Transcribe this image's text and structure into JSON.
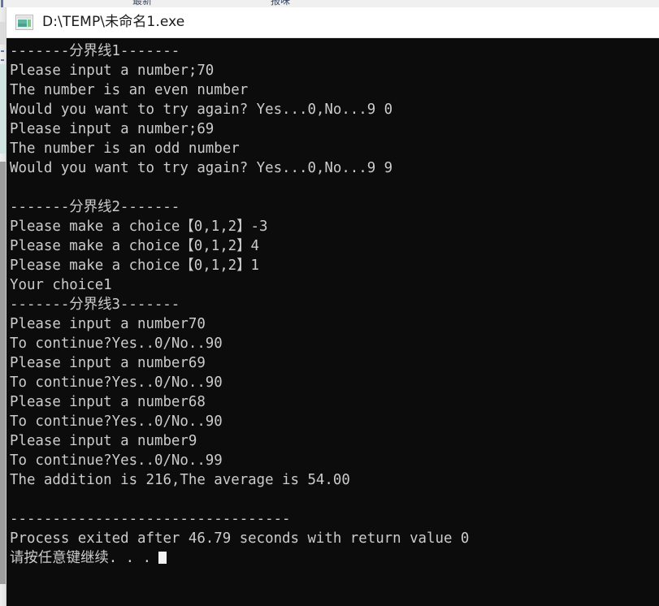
{
  "background_window": {
    "name": "partially-visible-background-window",
    "text_fragments": [
      "最新",
      "报味"
    ]
  },
  "console": {
    "titlebar": {
      "icon": "console-window-icon",
      "title": "D:\\TEMP\\未命名1.exe"
    },
    "colors": {
      "background": "#0c0c0c",
      "foreground": "#cccccc",
      "titlebar_background": "#ffffff",
      "titlebar_text": "#1a1a1a",
      "cursor": "#f2f2f2"
    },
    "lines": [
      "-------分界线1-------",
      "Please input a number;70",
      "The number is an even number",
      "Would you want to try again? Yes...0,No...9 0",
      "Please input a number;69",
      "The number is an odd number",
      "Would you want to try again? Yes...0,No...9 9",
      "",
      "-------分界线2-------",
      "Please make a choice【0,1,2】-3",
      "Please make a choice【0,1,2】4",
      "Please make a choice【0,1,2】1",
      "Your choice1",
      "-------分界线3-------",
      "Please input a number70",
      "To continue?Yes..0/No..90",
      "Please input a number69",
      "To continue?Yes..0/No..90",
      "Please input a number68",
      "To continue?Yes..0/No..90",
      "Please input a number9",
      "To continue?Yes..0/No..99",
      "The addition is 216,The average is 54.00",
      "",
      "---------------------------------",
      "Process exited after 46.79 seconds with return value 0",
      "请按任意键继续. . ."
    ],
    "cursor_visible": true
  }
}
